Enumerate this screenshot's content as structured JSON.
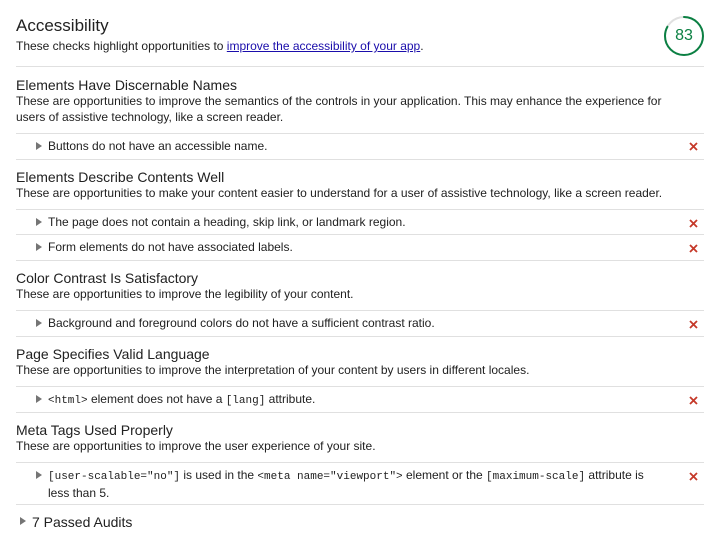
{
  "header": {
    "title": "Accessibility",
    "subtitle_prefix": "These checks highlight opportunities to ",
    "subtitle_link": "improve the accessibility of your app",
    "subtitle_suffix": ".",
    "score": "83",
    "score_fraction": 0.83,
    "score_color": "#0b8043"
  },
  "groups": [
    {
      "title": "Elements Have Discernable Names",
      "desc": "These are opportunities to improve the semantics of the controls in your application. This may enhance the experience for users of assistive technology, like a screen reader.",
      "audits": [
        "Buttons do not have an accessible name."
      ]
    },
    {
      "title": "Elements Describe Contents Well",
      "desc": "These are opportunities to make your content easier to understand for a user of assistive technology, like a screen reader.",
      "audits": [
        "The page does not contain a heading, skip link, or landmark region.",
        "Form elements do not have associated labels."
      ]
    },
    {
      "title": "Color Contrast Is Satisfactory",
      "desc": "These are opportunities to improve the legibility of your content.",
      "audits": [
        "Background and foreground colors do not have a sufficient contrast ratio."
      ]
    },
    {
      "title": "Page Specifies Valid Language",
      "desc": "These are opportunities to improve the interpretation of your content by users in different locales.",
      "audits": [
        {
          "code1": "<html>",
          "text1": " element does not have a ",
          "code2": "[lang]",
          "text2": " attribute."
        }
      ]
    },
    {
      "title": "Meta Tags Used Properly",
      "desc": "These are opportunities to improve the user experience of your site.",
      "audits": [
        {
          "code1": "[user-scalable=\"no\"]",
          "text1": " is used in the ",
          "code2": "<meta name=\"viewport\">",
          "text2": " element or the ",
          "code3": "[maximum-scale]",
          "text3": " attribute is less than 5."
        }
      ]
    }
  ],
  "passed_label": "7 Passed Audits",
  "colors": {
    "fail": "#c53929",
    "link": "#1a0dab",
    "pass": "#0b8043"
  }
}
